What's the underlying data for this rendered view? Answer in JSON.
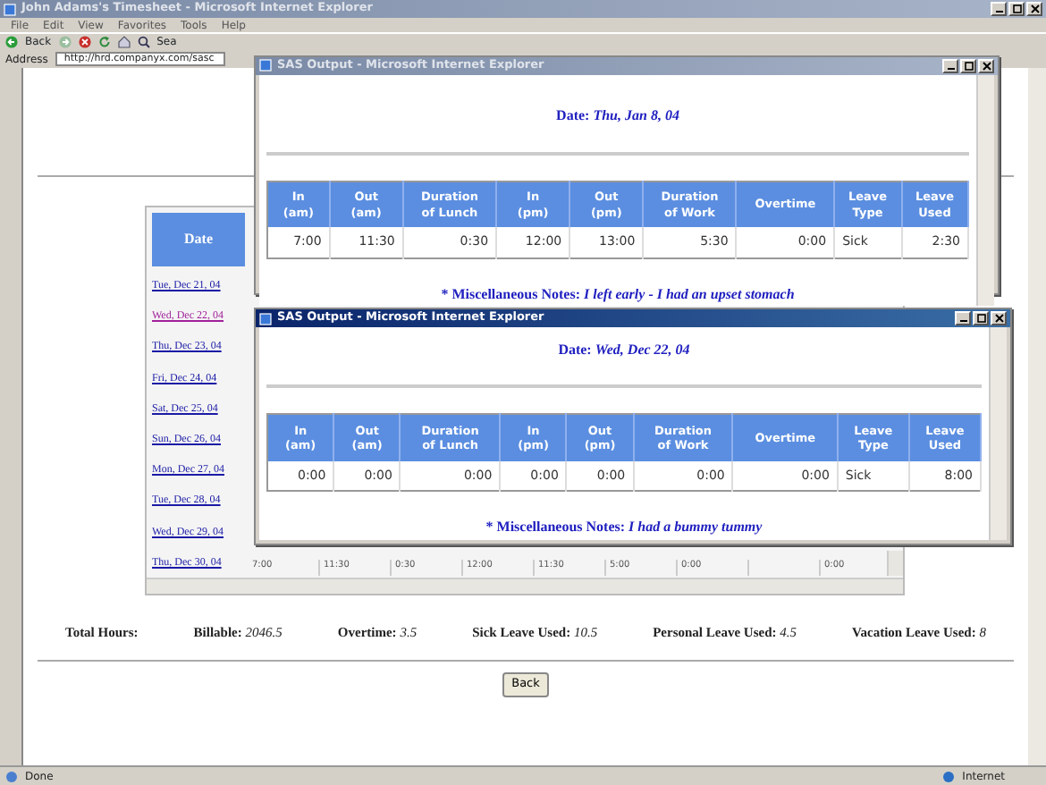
{
  "browser": {
    "title": "John Adams's Timesheet - Microsoft Internet Explorer",
    "active": false,
    "menu": [
      "File",
      "Edit",
      "View",
      "Favorites",
      "Tools",
      "Help"
    ],
    "back_label": "Back",
    "search_label": "Sea",
    "address_label": "Address",
    "address": "http://hrd.companyx.com/sasc",
    "status": "Done",
    "zone": "Internet"
  },
  "timesheet": {
    "date_header": "Date",
    "dates": [
      {
        "label": "Tue, Dec 21, 04",
        "visited": false
      },
      {
        "label": "Wed, Dec 22, 04",
        "visited": true
      },
      {
        "label": "Thu, Dec 23, 04",
        "visited": false
      },
      {
        "label": "Fri, Dec 24, 04",
        "visited": false
      },
      {
        "label": "Sat, Dec 25, 04",
        "visited": false
      },
      {
        "label": "Sun, Dec 26, 04",
        "visited": false
      },
      {
        "label": "Mon, Dec 27, 04",
        "visited": false
      },
      {
        "label": "Tue, Dec 28, 04",
        "visited": false
      },
      {
        "label": "Wed, Dec 29, 04",
        "visited": false
      },
      {
        "label": "Thu, Dec 30, 04",
        "visited": false
      }
    ],
    "last_row_cells": [
      "7:00",
      "11:30",
      "0:30",
      "12:00",
      "11:30",
      "5:00",
      "0:00",
      "",
      "0:00"
    ]
  },
  "totals": [
    "**Total Hours:**",
    "**Billable:** *2046.5*",
    "**Overtime:** *3.5*",
    "**Sick Leave Used:** *10.5*",
    "**Personal Leave Used:** *4.5*",
    "**Vacation Leave Used:** *8*"
  ],
  "back_button": "Back",
  "popups": [
    {
      "title": "SAS Output - Microsoft Internet Explorer",
      "active": false,
      "date": "Date: *Thu, Jan 8, 04*",
      "columns": [
        "In (am)",
        "Out (am)",
        "Duration of Lunch",
        "In (pm)",
        "Out (pm)",
        "Duration of Work",
        "Overtime",
        "Leave Type",
        "Leave Used"
      ],
      "row": [
        "7:00",
        "11:30",
        "0:30",
        "12:00",
        "13:00",
        "5:30",
        "0:00",
        "Sick",
        "2:30"
      ],
      "notes": "* Miscellaneous Notes: *I left early - I had an upset stomach*"
    },
    {
      "title": "SAS Output - Microsoft Internet Explorer",
      "active": true,
      "date": "Date: *Wed, Dec 22, 04*",
      "columns": [
        "In (am)",
        "Out (am)",
        "Duration of Lunch",
        "In (pm)",
        "Out (pm)",
        "Duration of Work",
        "Overtime",
        "Leave Type",
        "Leave Used"
      ],
      "row": [
        "0:00",
        "0:00",
        "0:00",
        "0:00",
        "0:00",
        "0:00",
        "0:00",
        "Sick",
        "8:00"
      ],
      "notes": "* Miscellaneous Notes: *I had a bummy tummy*"
    }
  ]
}
